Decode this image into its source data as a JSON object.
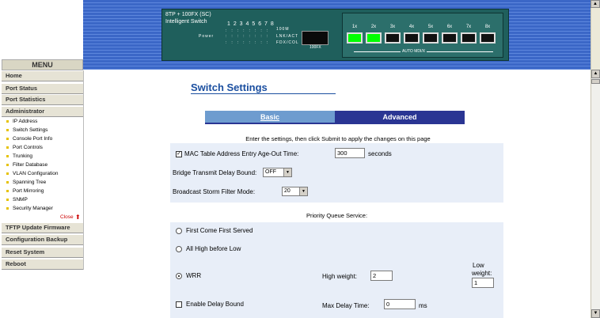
{
  "banner": {
    "model_line1": "8TP + 100FX (SC)",
    "model_line2": "Intelligent Switch",
    "led_numbers": "1 2 3 4 5 6 7 8",
    "led_100m": "100M",
    "led_power": "Power",
    "led_lnkact": "LNK/ACT",
    "led_fdxcol": "FDX/COL",
    "port_label": "100FX",
    "port_numbers": [
      "1x",
      "2x",
      "3x",
      "4x",
      "5x",
      "6x",
      "7x",
      "8x"
    ],
    "active_ports": [
      1,
      2
    ],
    "automdix": "AUTO MDI/X"
  },
  "menu": {
    "header": "MENU",
    "items": [
      {
        "label": "Home"
      },
      {
        "label": "Port Status"
      },
      {
        "label": "Port Statistics"
      },
      {
        "label": "Administrator"
      }
    ],
    "admin_sub": [
      "IP Address",
      "Switch Settings",
      "Console Port Info",
      "Port Controls",
      "Trunking",
      "Filter Database",
      "VLAN Configuration",
      "Spanning Tree",
      "Port Mirroring",
      "SNMP",
      "Security Manager"
    ],
    "close": "Close",
    "bottom_items": [
      "TFTP Update Firmware",
      "Configuration Backup",
      "Reset System",
      "Reboot"
    ]
  },
  "content": {
    "title": "Switch Settings",
    "tabs": {
      "basic": "Basic",
      "advanced": "Advanced"
    },
    "instructions": "Enter the settings, then click Submit to apply the changes on this page",
    "mac_age_label": "MAC Table Address Entry Age-Out Time:",
    "mac_age_value": "300",
    "mac_age_unit": "seconds",
    "mac_age_checked": true,
    "bridge_delay_label": "Bridge Transmit Delay Bound:",
    "bridge_delay_value": "OFF",
    "storm_label": "Broadcast Storm Filter Mode:",
    "storm_value": "20",
    "pq_label": "Priority Queue Service:",
    "fcfs_label": "First Come First Served",
    "high_before_low_label": "All High before Low",
    "wrr_label": "WRR",
    "high_weight_label": "High weight:",
    "high_weight_value": "2",
    "low_weight_label_1": "Low",
    "low_weight_label_2": "weight:",
    "low_weight_value": "1",
    "delay_bound_label": "Enable Delay Bound",
    "max_delay_label": "Max Delay Time:",
    "max_delay_value": "0",
    "max_delay_unit": "ms"
  }
}
